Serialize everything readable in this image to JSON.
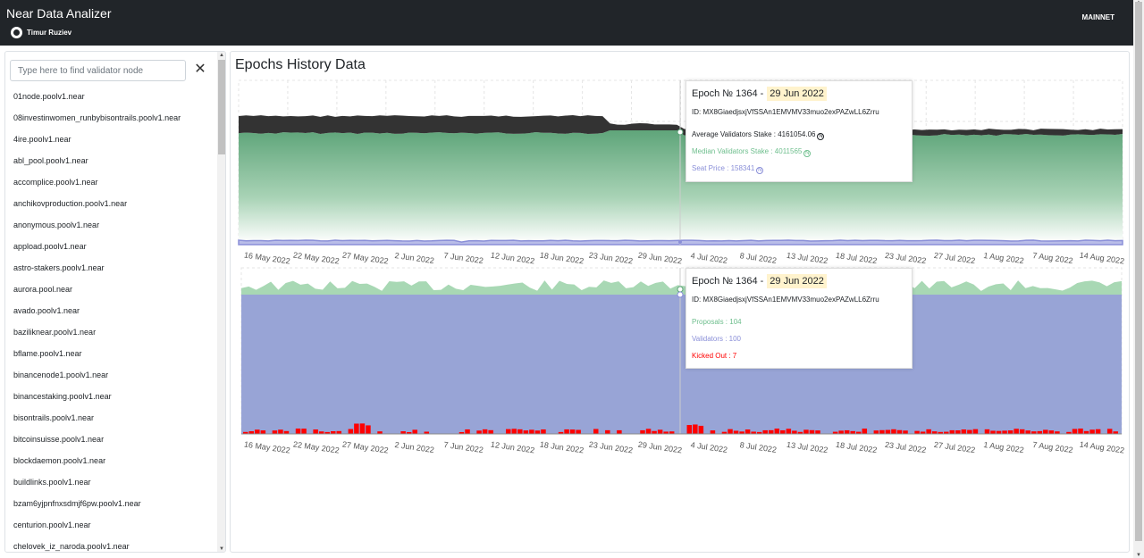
{
  "header": {
    "title": "Near Data Analizer",
    "author": "Timur Ruziev",
    "network": "MAINNET"
  },
  "sidebar": {
    "search_placeholder": "Type here to find validator node",
    "clear_label": "✕",
    "validators": [
      "01node.poolv1.near",
      "08investinwomen_runbybisontrails.poolv1.near",
      "4ire.poolv1.near",
      "abl_pool.poolv1.near",
      "accomplice.poolv1.near",
      "anchikovproduction.poolv1.near",
      "anonymous.poolv1.near",
      "appload.poolv1.near",
      "astro-stakers.poolv1.near",
      "aurora.pool.near",
      "avado.poolv1.near",
      "baziliknear.poolv1.near",
      "bflame.poolv1.near",
      "binancenode1.poolv1.near",
      "binancestaking.poolv1.near",
      "bisontrails.poolv1.near",
      "bitcoinsuisse.poolv1.near",
      "blockdaemon.poolv1.near",
      "buildlinks.poolv1.near",
      "bzam6yjpnfnxsdmjf6pw.poolv1.near",
      "centurion.poolv1.near",
      "chelovek_iz_naroda.poolv1.near"
    ]
  },
  "main": {
    "title": "Epochs History Data",
    "x_ticks": [
      "16 May 2022",
      "22 May 2022",
      "27 May 2022",
      "2 Jun 2022",
      "7 Jun 2022",
      "12 Jun 2022",
      "18 Jun 2022",
      "23 Jun 2022",
      "29 Jun 2022",
      "4 Jul 2022",
      "8 Jul 2022",
      "13 Jul 2022",
      "18 Jul 2022",
      "23 Jul 2022",
      "27 Jul 2022",
      "1 Aug 2022",
      "7 Aug 2022",
      "14 Aug 2022"
    ],
    "tooltip_stake": {
      "epoch_label": "Epoch № 1364 -",
      "date": "29 Jun 2022",
      "id": "ID: MX8GiaedjsxjVfSSAn1EMVMV33muo2exPAZwLL6Zrru",
      "avg": "Average Validators Stake : 4161054.06",
      "median": "Median Validators Stake : 4011565",
      "seat": "Seat Price : 158341"
    },
    "tooltip_validators": {
      "epoch_label": "Epoch № 1364 -",
      "date": "29 Jun 2022",
      "id": "ID: MX8GiaedjsxjVfSSAn1EMVMV33muo2exPAZwLL6Zrru",
      "proposals": "Proposals : 104",
      "validators": "Validators : 100",
      "kicked": "Kicked Out : 7"
    },
    "near_symbol": "N"
  },
  "chart_data": [
    {
      "type": "area",
      "series": [
        {
          "name": "Average Validators Stake",
          "color": "#333333"
        },
        {
          "name": "Median Validators Stake",
          "color": "#6fbf8e"
        },
        {
          "name": "Seat Price",
          "color": "#8a8fd8"
        }
      ],
      "highlight": {
        "epoch": 1364,
        "date": "29 Jun 2022",
        "avg": 4161054.06,
        "median": 4011565,
        "seat": 158341
      }
    },
    {
      "type": "area",
      "series": [
        {
          "name": "Proposals",
          "color": "#a8d8b4"
        },
        {
          "name": "Validators",
          "color": "#98a4d6"
        },
        {
          "name": "Kicked Out",
          "color": "#ff0000"
        }
      ],
      "highlight": {
        "epoch": 1364,
        "date": "29 Jun 2022",
        "proposals": 104,
        "validators": 100,
        "kicked": 7
      }
    }
  ],
  "colors": {
    "topbar": "#212529",
    "accent_date": "#fff3cd",
    "kicked": "#ff0000"
  }
}
